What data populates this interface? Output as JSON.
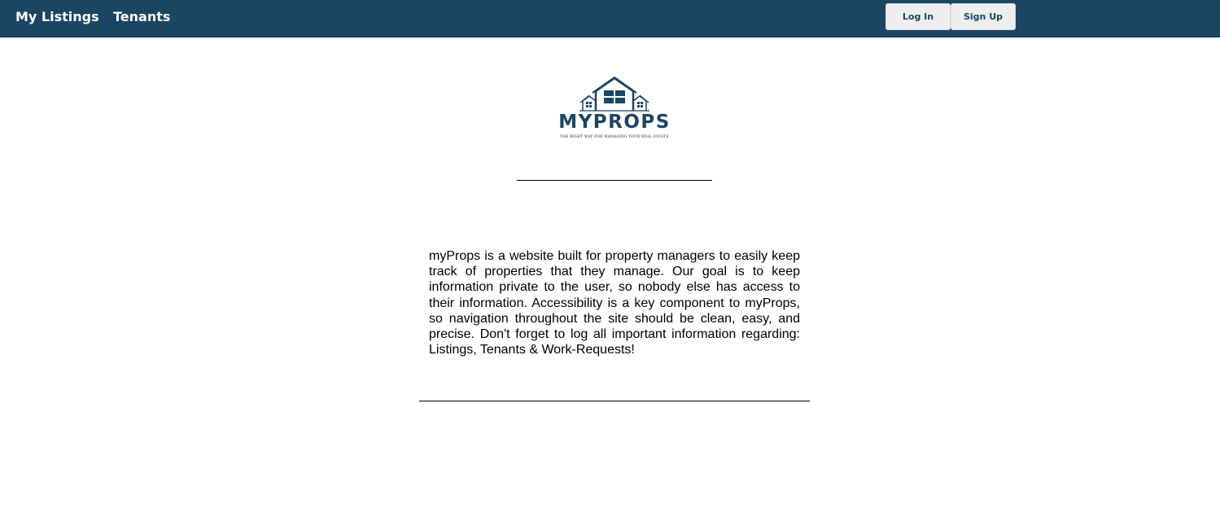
{
  "nav": {
    "links": [
      "My Listings",
      "Tenants"
    ],
    "login_label": "Log In",
    "signup_label": "Sign Up"
  },
  "logo": {
    "name": "MYPROPS",
    "tagline": "THE RIGHT WAY FOR MANAGING YOUR REAL ESTATE",
    "icon": "house-icon"
  },
  "about": {
    "text": "myProps is a website built for property managers to easily keep track of properties that they manage. Our goal is to keep information private to the user, so nobody else has access to their information. Accessibility is a key component to myProps, so navigation throughout the site should be clean, easy, and precise. Don't forget to log all important information regarding: Listings, Tenants & Work-Requests!"
  },
  "colors": {
    "navbar": "#1b4563",
    "brand": "#1b4563",
    "button_bg": "#eeeeee"
  }
}
